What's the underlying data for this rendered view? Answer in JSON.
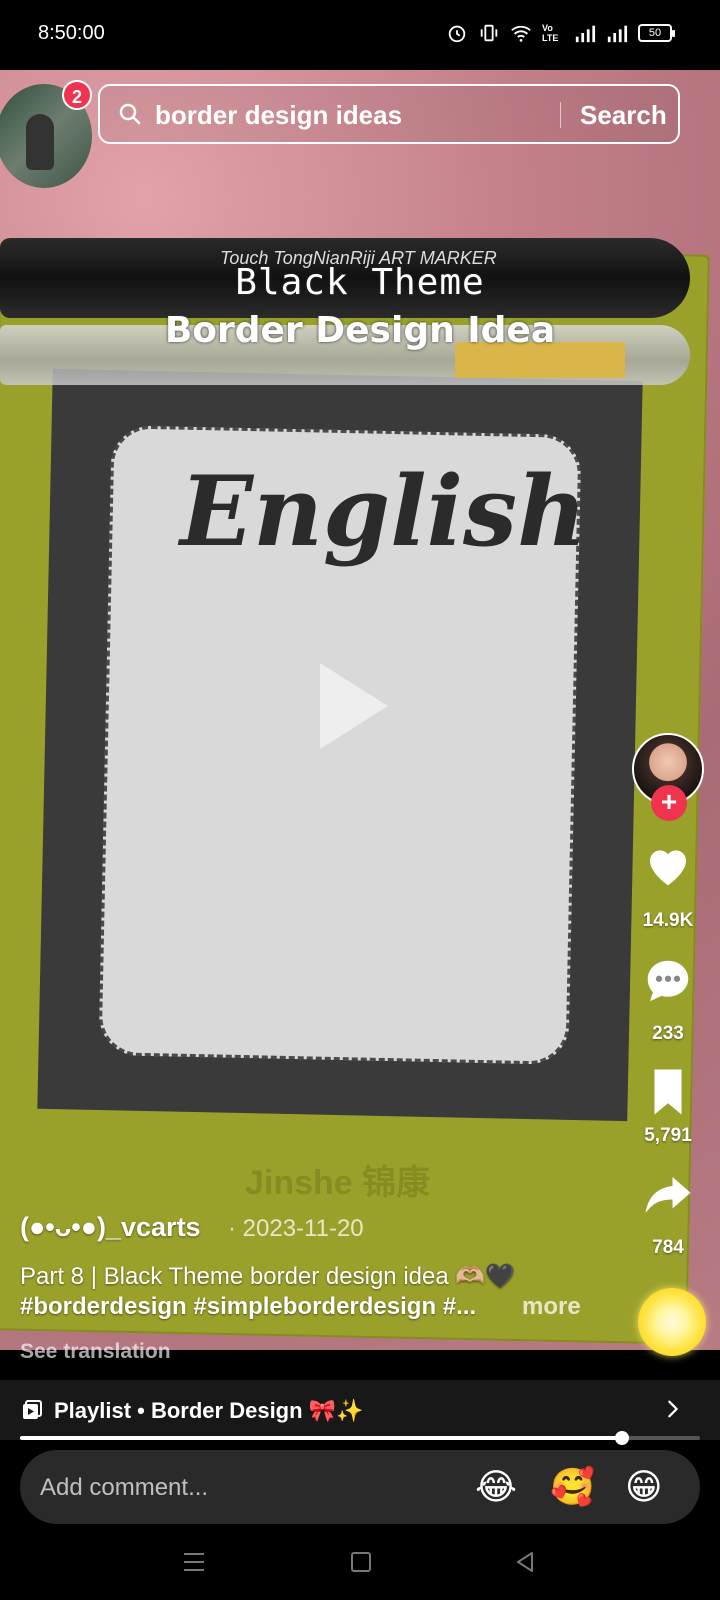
{
  "status_bar": {
    "time": "8:50:00",
    "battery": "50",
    "network_label": "Vo LTE"
  },
  "video": {
    "overlay_title_line1": "Black Theme",
    "overlay_title_line2": "Border Design Idea",
    "paper_heading": "English",
    "book_emboss": "Jinshe 锦康",
    "pen_brand": "Touch TongNianRiji ART MARKER"
  },
  "top_left": {
    "notification_count": "2"
  },
  "search": {
    "query": "border design ideas",
    "button_label": "Search"
  },
  "side_rail": {
    "likes": "14.9K",
    "comments": "233",
    "saves": "5,791",
    "shares": "784"
  },
  "post": {
    "author": "(●•ᴗ•●)_vcarts",
    "date": "· 2023-11-20",
    "caption_line1": "Part 8 | Black Theme border design idea 🫶🏼🖤",
    "caption_line2": "#borderdesign #simpleborderdesign #...",
    "more_label": "more",
    "see_translation": "See translation"
  },
  "playlist": {
    "label": "Playlist • Border Design 🎀✨"
  },
  "progress": {
    "fraction": 0.885
  },
  "comment": {
    "placeholder": "Add comment...",
    "emojis": [
      "😂",
      "🥰",
      "😁"
    ]
  },
  "colors": {
    "accent_red": "#f0334f",
    "background": "#000000",
    "comment_bar": "#2a2a2a"
  }
}
